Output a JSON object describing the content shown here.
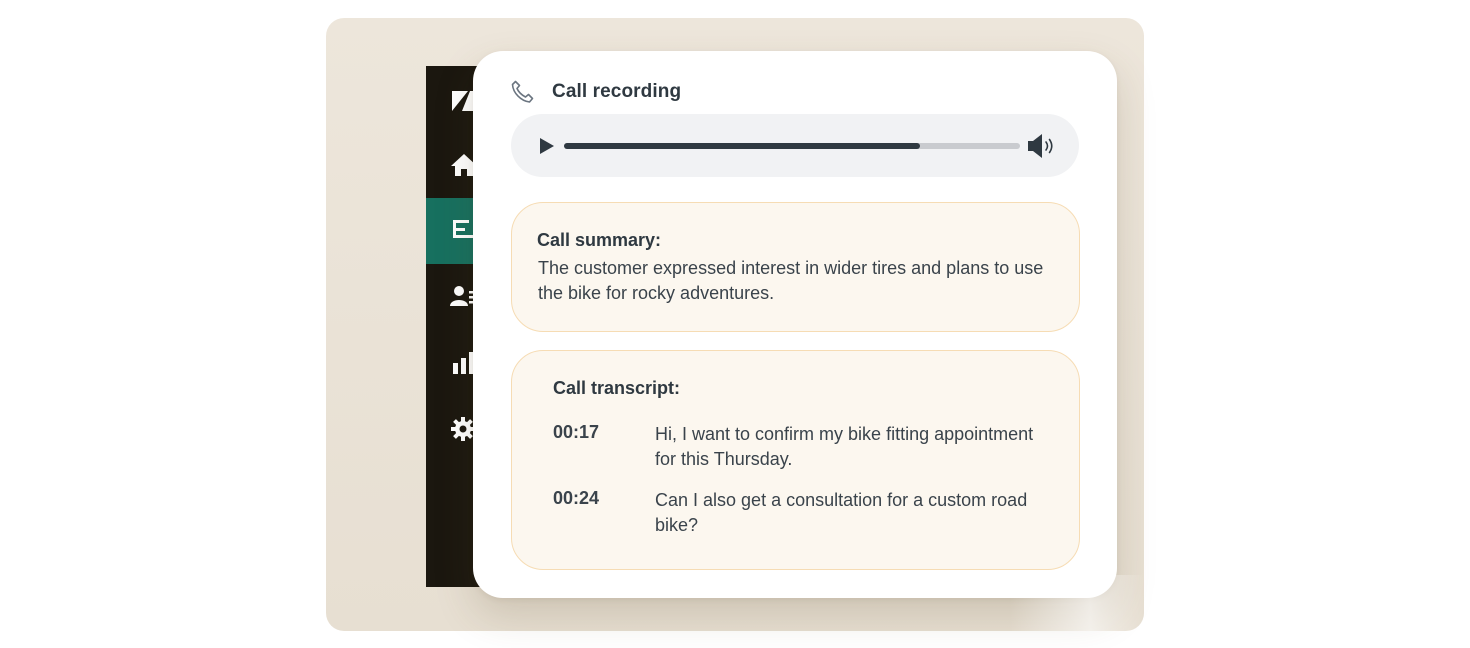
{
  "colors": {
    "stage_bg": "#ede6db",
    "sidebar_bg": "#1b170f",
    "sidebar_active": "#17705f",
    "box_bg": "#fcf7ef",
    "box_border": "#f6dcb4",
    "text_dark": "#2f3941",
    "player_bg": "#f1f2f4"
  },
  "sidebar": {
    "items": [
      {
        "icon": "logo-icon",
        "active": false
      },
      {
        "icon": "home-icon",
        "active": false
      },
      {
        "icon": "tickets-icon",
        "active": true
      },
      {
        "icon": "customers-icon",
        "active": false
      },
      {
        "icon": "reports-icon",
        "active": false
      },
      {
        "icon": "settings-icon",
        "active": false
      }
    ]
  },
  "recording": {
    "title": "Call recording",
    "icon": "phone-icon",
    "progress": 0.78,
    "play_icon": "play-icon",
    "volume_icon": "volume-icon"
  },
  "summary": {
    "label": "Call summary:",
    "text": "The customer expressed interest in wider tires and plans to use the bike for rocky adventures."
  },
  "transcript": {
    "label": "Call transcript:",
    "entries": [
      {
        "time": "00:17",
        "text": "Hi, I want to confirm my bike fitting appointment for this Thursday."
      },
      {
        "time": "00:24",
        "text": "Can I also get a consultation for a custom road bike?"
      }
    ]
  }
}
